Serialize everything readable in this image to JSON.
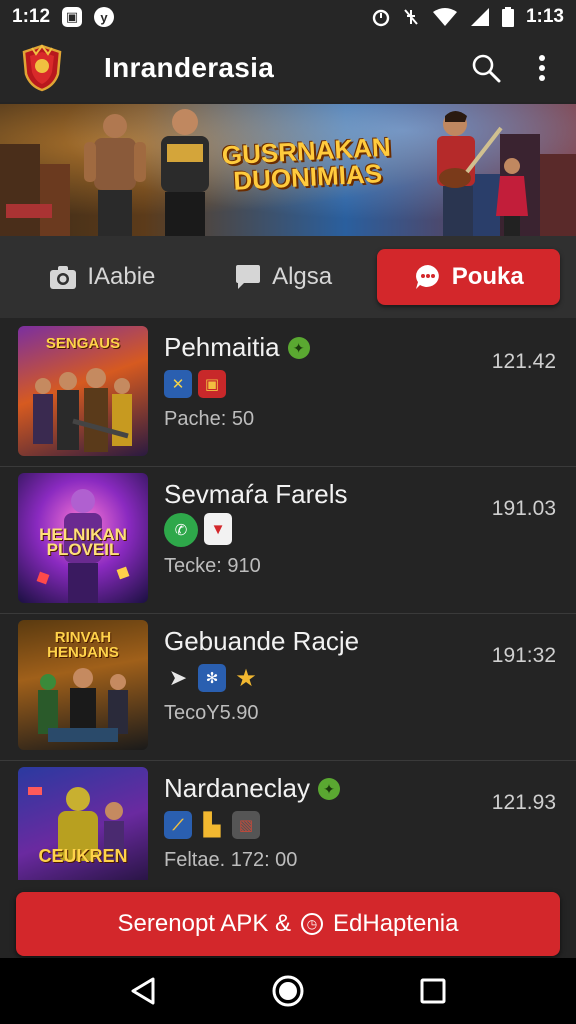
{
  "status_bar": {
    "time_left": "1:12",
    "time_right": "1:13"
  },
  "app_bar": {
    "title": "Inranderasia",
    "search_icon": "search-icon",
    "menu_icon": "more-vert-icon"
  },
  "hero": {
    "title": "GUSRNAKAN DUONIMIAS"
  },
  "tabs": [
    {
      "label": "IAabie",
      "icon": "camera-icon",
      "active": false
    },
    {
      "label": "Algsa",
      "icon": "chat-bubble-icon",
      "active": false
    },
    {
      "label": "Pouka",
      "icon": "message-icon",
      "active": true
    }
  ],
  "items": [
    {
      "title": "Pehmaitia",
      "meta": "Pache: 50",
      "value": "121.42",
      "thumb_caption": "SENGAUS",
      "verified": true
    },
    {
      "title": "Sevmaŕa Farels",
      "meta": "Tecke: 910",
      "value": "191.03",
      "thumb_caption": "HELNIKAN PLOVEIL",
      "verified": false
    },
    {
      "title": "Gebuande Racje",
      "meta": "TecoY5.90",
      "value": "191:32",
      "thumb_caption": "RINVAH HENJANS",
      "verified": false
    },
    {
      "title": "Nardaneclay",
      "meta": "Feltae. 172: 00",
      "value": "121.93",
      "thumb_caption": "CEUKREN",
      "verified": true
    }
  ],
  "download": {
    "label_left": "Serenopt APK &",
    "label_right": "EdHaptenia"
  },
  "colors": {
    "accent": "#d3272b",
    "background": "#242424",
    "bar": "#262626"
  }
}
